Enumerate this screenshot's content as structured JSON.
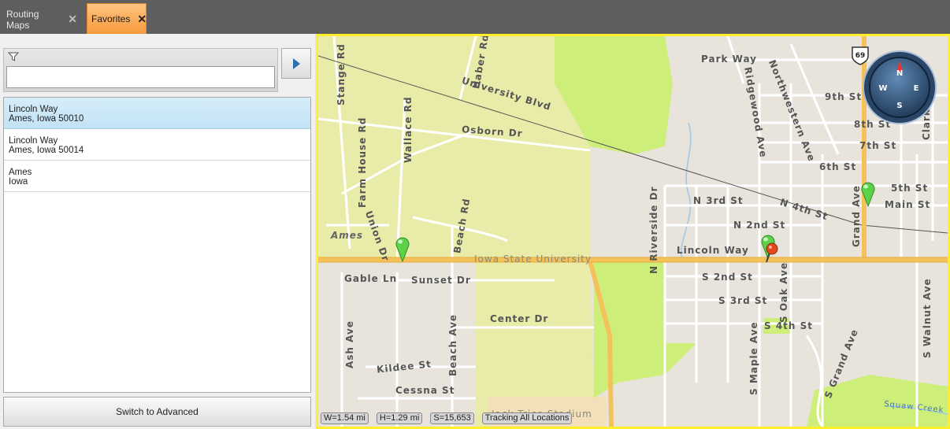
{
  "tabs": [
    {
      "label": "Routing Maps",
      "close": "✕"
    },
    {
      "label": "Favorites",
      "close": "✕"
    }
  ],
  "search": {
    "value": "",
    "placeholder": ""
  },
  "favorites": [
    {
      "line1": "Lincoln Way",
      "line2": "Ames, Iowa  50010"
    },
    {
      "line1": "Lincoln Way",
      "line2": "Ames, Iowa  50014"
    },
    {
      "line1": "Ames",
      "line2": "Iowa"
    }
  ],
  "advanced_button": "Switch to Advanced",
  "map": {
    "labels": {
      "park_way": "Park Way",
      "ninth": "9th St",
      "eighth": "8th St",
      "seventh": "7th St",
      "sixth": "6th St",
      "fifth": "5th St",
      "main": "Main St",
      "n3rd": "N 3rd St",
      "n2nd": "N 2nd St",
      "n4th": "N 4th St",
      "lincoln": "Lincoln Way",
      "s2nd": "S 2nd St",
      "s3rd": "S 3rd St",
      "s4th": "S 4th St",
      "university": "University Blvd",
      "osborn": "Osborn Dr",
      "gable": "Gable Ln",
      "sunset": "Sunset Dr",
      "center": "Center Dr",
      "kildee": "Kildee St",
      "cessna": "Cessna St",
      "ames": "Ames",
      "isu": "Iowa State University",
      "jack": "Jack Trice Stadium",
      "squaw": "Squaw Creek",
      "stange": "Stange Rd",
      "haber": "Haber Rd",
      "farmhouse": "Farm House Rd",
      "wallace": "Wallace Rd",
      "union": "Union Dr",
      "beach_rd": "Beach Rd",
      "ash": "Ash Ave",
      "beach_ave": "Beach Ave",
      "riverside": "N Riverside Dr",
      "ridgewood": "Ridgewood Ave",
      "northwestern": "Northwestern Ave",
      "grand": "Grand Ave",
      "s_grand": "S Grand Ave",
      "s_maple": "S Maple Ave",
      "s_oak": "S Oak Ave",
      "s_walnut": "S Walnut Ave",
      "clark": "Clark Ave",
      "hwy": "69"
    },
    "compass": {
      "n": "N",
      "e": "E",
      "s": "S",
      "w": "W"
    },
    "status": {
      "width": "W=1.54 mi",
      "height": "H=1.29 mi",
      "scale": "S=15,653",
      "tracking": "Tracking All Locations"
    }
  },
  "colors": {
    "campus": "#e9eba8",
    "park": "#cdee79",
    "highway": "#f4c25a",
    "selected_tab": "#f79a3b",
    "map_border": "#ffee2a",
    "pin_green": "#5cd24a",
    "pin_red": "#e24a1e"
  }
}
